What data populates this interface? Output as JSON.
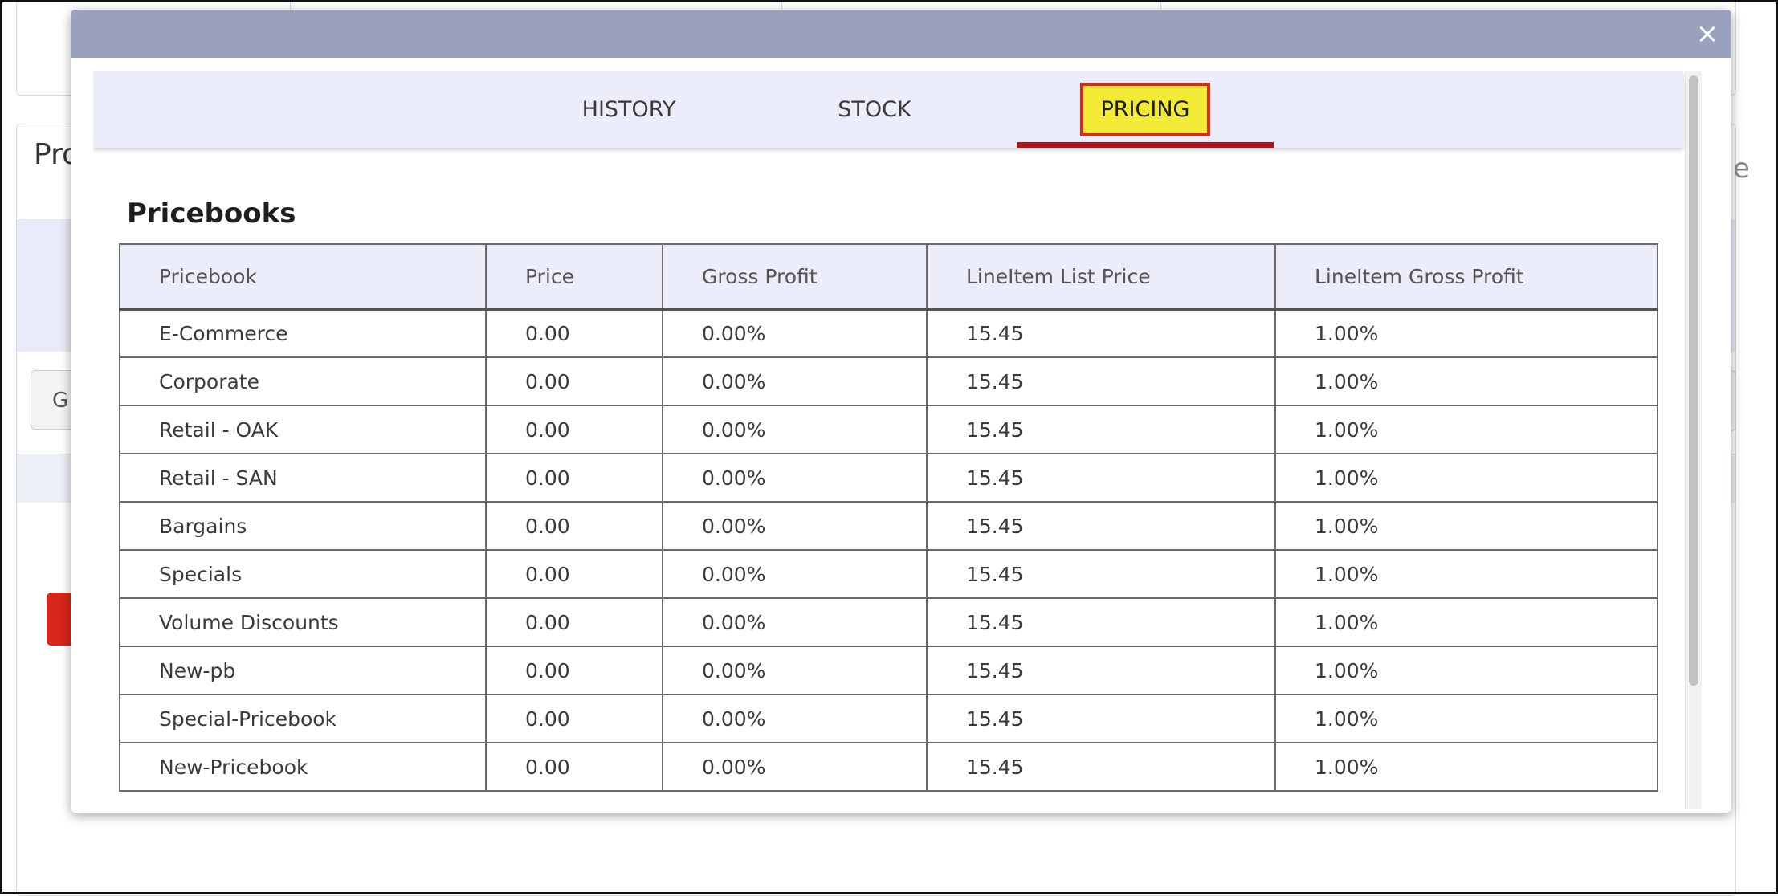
{
  "background": {
    "card_title": "Pro",
    "input_text": "G",
    "edge_glyph": "e"
  },
  "modal": {
    "close_label": "×",
    "tabs": [
      {
        "label": "HISTORY",
        "active": false
      },
      {
        "label": "STOCK",
        "active": false
      },
      {
        "label": "PRICING",
        "active": true
      }
    ],
    "section_title": "Pricebooks",
    "table": {
      "headers": [
        "Pricebook",
        "Price",
        "Gross Profit",
        "LineItem List Price",
        "LineItem Gross Profit"
      ],
      "rows": [
        [
          "E-Commerce",
          "0.00",
          "0.00%",
          "15.45",
          "1.00%"
        ],
        [
          "Corporate",
          "0.00",
          "0.00%",
          "15.45",
          "1.00%"
        ],
        [
          "Retail - OAK",
          "0.00",
          "0.00%",
          "15.45",
          "1.00%"
        ],
        [
          "Retail - SAN",
          "0.00",
          "0.00%",
          "15.45",
          "1.00%"
        ],
        [
          "Bargains",
          "0.00",
          "0.00%",
          "15.45",
          "1.00%"
        ],
        [
          "Specials",
          "0.00",
          "0.00%",
          "15.45",
          "1.00%"
        ],
        [
          "Volume Discounts",
          "0.00",
          "0.00%",
          "15.45",
          "1.00%"
        ],
        [
          "New-pb",
          "0.00",
          "0.00%",
          "15.45",
          "1.00%"
        ],
        [
          "Special-Pricebook",
          "0.00",
          "0.00%",
          "15.45",
          "1.00%"
        ],
        [
          "New-Pricebook",
          "0.00",
          "0.00%",
          "15.45",
          "1.00%"
        ]
      ]
    }
  },
  "colors": {
    "header_bar": "#99a1bc",
    "tab_bar": "#ebeefa",
    "active_tab_fill": "#f2ea36",
    "active_tab_border": "#d62b18",
    "active_underline": "#b3141c"
  }
}
